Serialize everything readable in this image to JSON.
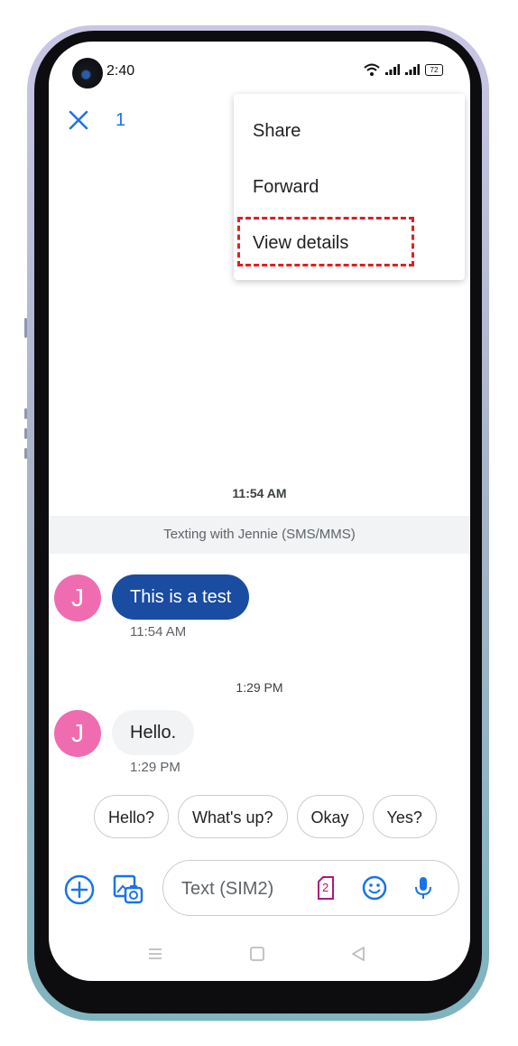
{
  "status_bar": {
    "time": "2:40",
    "battery": "72"
  },
  "header": {
    "selected_count": "1"
  },
  "menu": {
    "items": [
      {
        "label": "Share"
      },
      {
        "label": "Forward"
      },
      {
        "label": "View details"
      }
    ]
  },
  "conversation": {
    "timestamp_1": "11:54 AM",
    "info": "Texting with Jennie (SMS/MMS)",
    "messages": [
      {
        "avatar": "J",
        "text": "This is a test",
        "time": "11:54 AM"
      },
      {
        "avatar": "J",
        "text": "Hello.",
        "time": "1:29 PM"
      }
    ],
    "timestamp_2": "1:29 PM"
  },
  "smart_replies": [
    "Hello?",
    "What's up?",
    "Okay",
    "Yes?"
  ],
  "compose": {
    "placeholder": "Text (SIM2)",
    "sim_number": "2"
  },
  "colors": {
    "accent": "#1a73e8",
    "outgoing_bubble": "#1a4ca1",
    "avatar": "#f06cb0",
    "highlight": "#e41e1e"
  }
}
